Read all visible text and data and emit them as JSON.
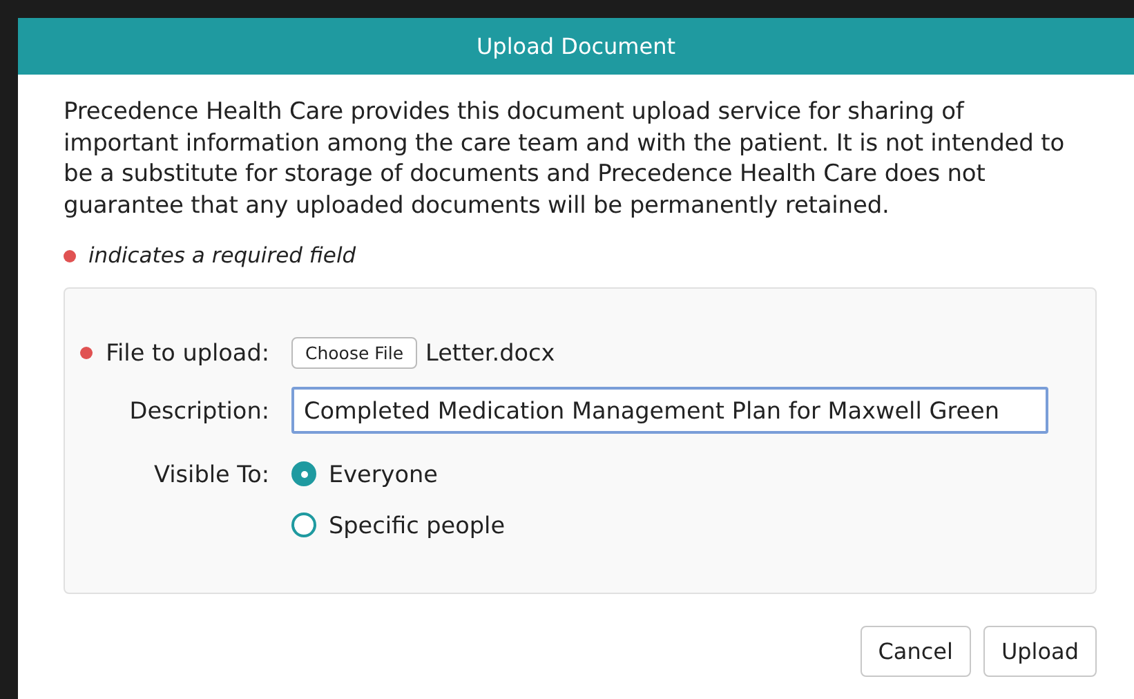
{
  "dialog": {
    "title": "Upload Document"
  },
  "notice": "Precedence Health Care provides this document upload service for sharing of important information among the care team and with the patient. It is not intended to be a substitute for storage of documents and Precedence Health Care does not guarantee that any uploaded documents will be permanently retained.",
  "required_note": "indicates a required field",
  "form": {
    "file": {
      "label": "File to upload:",
      "required": true,
      "button": "Choose File",
      "filename": "Letter.docx"
    },
    "description": {
      "label": "Description:",
      "required": false,
      "value": "Completed Medication Management Plan for Maxwell Green"
    },
    "visibility": {
      "label": "Visible To:",
      "required": false,
      "options": [
        {
          "label": "Everyone",
          "selected": true
        },
        {
          "label": "Specific people",
          "selected": false
        }
      ]
    }
  },
  "buttons": [
    "Cancel",
    "Upload"
  ]
}
